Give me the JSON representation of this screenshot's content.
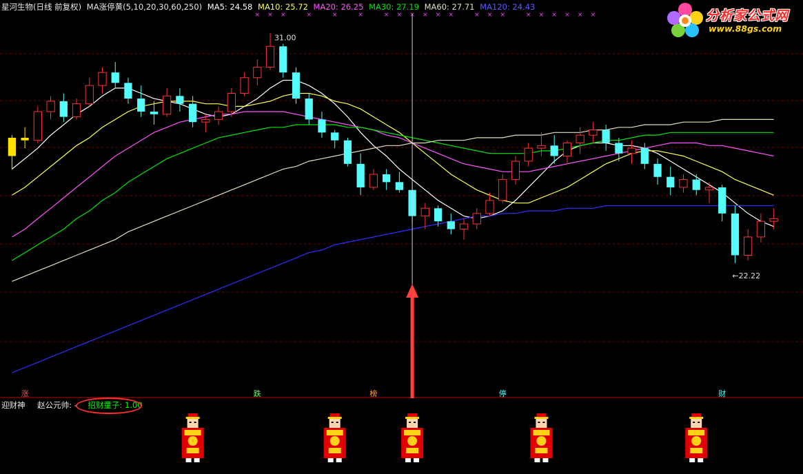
{
  "header": {
    "stock": "星河生物(日线 前复权)",
    "indicator": "MA涨停黄(5,10,20,30,60,250)",
    "ma5": "MA5: 24.58",
    "ma10": "MA10: 25.72",
    "ma20": "MA20: 26.25",
    "ma30": "MA30: 27.19",
    "ma60": "MA60: 27.71",
    "ma120": "MA120: 24.43"
  },
  "logo": {
    "name": "分析家公式网",
    "url": "www.88gs.com"
  },
  "price_labels": {
    "high": "31.00",
    "low": "←22.22"
  },
  "bottom_labels": [
    "涨",
    "跌",
    "榜",
    "停",
    "财"
  ],
  "sub_panel": {
    "title": "迎财神",
    "field1": "赵公元帅: -",
    "field2": "招财童子: 1.00"
  },
  "colors": {
    "background": "#000000",
    "up": "#ff3232",
    "down": "#54fcfc",
    "ma5": "#ffffff",
    "ma10": "#ffff54",
    "ma20": "#ff54ff",
    "ma30": "#00e600",
    "ma60": "#e0e0c0",
    "ma120": "#3030ff",
    "arrow": "#ff4040"
  },
  "chart_data": {
    "type": "candlestick",
    "y_axis_scale": "price",
    "ylim": [
      17.5,
      31.8
    ],
    "high_marker": 31.0,
    "low_marker": 22.22,
    "candles": [
      [
        26.3,
        27.1,
        25.8,
        27.0
      ],
      [
        27.0,
        27.4,
        26.6,
        26.9
      ],
      [
        26.9,
        28.2,
        26.8,
        28.0
      ],
      [
        28.0,
        28.6,
        27.7,
        28.4
      ],
      [
        28.4,
        28.7,
        27.6,
        27.8
      ],
      [
        27.8,
        28.5,
        27.7,
        28.3
      ],
      [
        28.3,
        29.3,
        28.2,
        29.0
      ],
      [
        29.0,
        29.7,
        28.7,
        29.5
      ],
      [
        29.5,
        29.9,
        28.9,
        29.1
      ],
      [
        29.1,
        29.3,
        28.3,
        28.5
      ],
      [
        28.5,
        29.0,
        27.8,
        28.0
      ],
      [
        28.0,
        28.4,
        27.5,
        27.9
      ],
      [
        27.9,
        28.9,
        27.8,
        28.6
      ],
      [
        28.6,
        28.9,
        28.0,
        28.3
      ],
      [
        28.3,
        28.6,
        27.4,
        27.6
      ],
      [
        27.6,
        27.9,
        27.2,
        27.7
      ],
      [
        27.7,
        28.2,
        27.5,
        28.0
      ],
      [
        28.0,
        28.9,
        27.8,
        28.7
      ],
      [
        28.7,
        29.5,
        28.6,
        29.3
      ],
      [
        29.3,
        30.0,
        29.0,
        29.7
      ],
      [
        29.7,
        31.0,
        29.6,
        30.5
      ],
      [
        30.5,
        30.6,
        29.3,
        29.5
      ],
      [
        29.5,
        29.7,
        28.3,
        28.5
      ],
      [
        28.5,
        28.7,
        27.5,
        27.7
      ],
      [
        27.7,
        28.0,
        27.0,
        27.2
      ],
      [
        27.2,
        27.3,
        26.6,
        26.9
      ],
      [
        26.9,
        27.0,
        25.9,
        26.0
      ],
      [
        26.0,
        26.4,
        24.8,
        25.1
      ],
      [
        25.1,
        25.8,
        25.0,
        25.6
      ],
      [
        25.6,
        25.8,
        25.0,
        25.3
      ],
      [
        25.3,
        25.7,
        24.9,
        25.0
      ],
      [
        25.0,
        25.3,
        23.7,
        24.0
      ],
      [
        24.0,
        24.5,
        23.5,
        24.3
      ],
      [
        24.3,
        24.4,
        23.6,
        23.8
      ],
      [
        23.8,
        24.1,
        23.3,
        23.5
      ],
      [
        23.5,
        23.9,
        23.1,
        23.7
      ],
      [
        23.7,
        24.3,
        23.5,
        24.1
      ],
      [
        24.1,
        24.9,
        24.0,
        24.6
      ],
      [
        24.6,
        25.6,
        24.5,
        25.4
      ],
      [
        25.4,
        26.3,
        25.2,
        26.1
      ],
      [
        26.1,
        26.8,
        25.9,
        26.6
      ],
      [
        26.6,
        27.2,
        26.3,
        26.7
      ],
      [
        26.7,
        27.1,
        26.0,
        26.3
      ],
      [
        26.3,
        26.9,
        26.0,
        26.8
      ],
      [
        26.8,
        27.4,
        26.4,
        27.1
      ],
      [
        27.1,
        27.6,
        26.8,
        27.3
      ],
      [
        27.3,
        27.5,
        26.5,
        26.8
      ],
      [
        26.8,
        27.0,
        26.1,
        26.4
      ],
      [
        26.4,
        26.9,
        26.0,
        26.6
      ],
      [
        26.6,
        26.8,
        25.8,
        26.0
      ],
      [
        26.0,
        26.2,
        25.2,
        25.5
      ],
      [
        25.5,
        25.9,
        24.8,
        25.1
      ],
      [
        25.1,
        25.6,
        24.9,
        25.4
      ],
      [
        25.4,
        25.6,
        24.8,
        25.0
      ],
      [
        25.0,
        25.3,
        24.5,
        25.1
      ],
      [
        25.1,
        25.2,
        23.8,
        24.1
      ],
      [
        24.1,
        24.4,
        22.2,
        22.5
      ],
      [
        22.5,
        23.5,
        22.3,
        23.2
      ],
      [
        23.2,
        24.1,
        23.0,
        23.8
      ],
      [
        23.8,
        24.3,
        23.5,
        23.9
      ]
    ],
    "series": [
      {
        "name": "MA5",
        "values": [
          25.8,
          26.2,
          26.6,
          27.1,
          27.5,
          27.9,
          28.2,
          28.6,
          28.9,
          28.9,
          28.7,
          28.5,
          28.4,
          28.3,
          28.1,
          27.9,
          27.8,
          27.9,
          28.2,
          28.5,
          28.9,
          29.2,
          29.2,
          29.0,
          28.7,
          28.3,
          27.8,
          27.2,
          26.7,
          26.3,
          25.8,
          25.4,
          25.0,
          24.6,
          24.3,
          24.0,
          23.9,
          24.0,
          24.2,
          24.6,
          25.1,
          25.6,
          26.1,
          26.5,
          26.7,
          26.8,
          26.8,
          26.7,
          26.7,
          26.6,
          26.4,
          26.1,
          25.8,
          25.5,
          25.2,
          24.9,
          24.5,
          24.1,
          23.8,
          23.6
        ]
      },
      {
        "name": "MA10",
        "values": [
          24.8,
          25.1,
          25.5,
          25.9,
          26.3,
          26.7,
          27.0,
          27.4,
          27.7,
          28.0,
          28.2,
          28.3,
          28.4,
          28.4,
          28.4,
          28.3,
          28.3,
          28.2,
          28.2,
          28.3,
          28.4,
          28.6,
          28.7,
          28.7,
          28.6,
          28.4,
          28.3,
          28.1,
          27.8,
          27.5,
          27.2,
          26.8,
          26.4,
          26.0,
          25.6,
          25.3,
          25.0,
          24.8,
          24.6,
          24.5,
          24.5,
          24.7,
          24.9,
          25.1,
          25.4,
          25.7,
          26.0,
          26.2,
          26.4,
          26.5,
          26.5,
          26.4,
          26.3,
          26.1,
          25.9,
          25.7,
          25.4,
          25.2,
          25.0,
          24.8
        ]
      },
      {
        "name": "MA20",
        "values": [
          23.2,
          23.5,
          23.9,
          24.3,
          24.7,
          25.1,
          25.5,
          25.9,
          26.3,
          26.6,
          26.9,
          27.2,
          27.4,
          27.6,
          27.7,
          27.8,
          27.9,
          27.9,
          28.0,
          28.0,
          28.0,
          28.0,
          27.9,
          27.8,
          27.7,
          27.6,
          27.5,
          27.4,
          27.3,
          27.1,
          27.0,
          26.8,
          26.6,
          26.4,
          26.2,
          26.0,
          25.9,
          25.8,
          25.7,
          25.7,
          25.7,
          25.8,
          25.9,
          26.0,
          26.1,
          26.2,
          26.3,
          26.4,
          26.5,
          26.6,
          26.7,
          26.8,
          26.8,
          26.8,
          26.7,
          26.7,
          26.6,
          26.5,
          26.4,
          26.3
        ]
      },
      {
        "name": "MA30",
        "values": [
          22.3,
          22.6,
          22.9,
          23.2,
          23.5,
          23.9,
          24.2,
          24.6,
          24.9,
          25.3,
          25.6,
          25.9,
          26.2,
          26.4,
          26.6,
          26.8,
          27.0,
          27.1,
          27.2,
          27.3,
          27.4,
          27.4,
          27.5,
          27.5,
          27.5,
          27.5,
          27.4,
          27.4,
          27.3,
          27.2,
          27.1,
          27.0,
          26.9,
          26.8,
          26.7,
          26.6,
          26.5,
          26.4,
          26.4,
          26.4,
          26.4,
          26.5,
          26.5,
          26.6,
          26.7,
          26.8,
          26.9,
          26.9,
          27.0,
          27.1,
          27.1,
          27.2,
          27.2,
          27.2,
          27.2,
          27.2,
          27.2,
          27.2,
          27.2,
          27.2
        ]
      },
      {
        "name": "MA60",
        "values": [
          21.5,
          21.7,
          21.9,
          22.1,
          22.3,
          22.5,
          22.7,
          22.9,
          23.1,
          23.4,
          23.6,
          23.8,
          24.0,
          24.2,
          24.4,
          24.6,
          24.8,
          25.0,
          25.2,
          25.4,
          25.6,
          25.8,
          25.9,
          26.1,
          26.2,
          26.3,
          26.4,
          26.5,
          26.6,
          26.7,
          26.7,
          26.8,
          26.8,
          26.9,
          26.9,
          26.9,
          27.0,
          27.0,
          27.0,
          27.1,
          27.1,
          27.1,
          27.2,
          27.2,
          27.2,
          27.3,
          27.3,
          27.4,
          27.4,
          27.5,
          27.5,
          27.5,
          27.6,
          27.6,
          27.6,
          27.7,
          27.7,
          27.7,
          27.7,
          27.7
        ]
      },
      {
        "name": "MA120",
        "values": [
          18.0,
          18.2,
          18.4,
          18.6,
          18.8,
          19.0,
          19.2,
          19.4,
          19.6,
          19.8,
          20.0,
          20.2,
          20.4,
          20.6,
          20.8,
          21.0,
          21.2,
          21.4,
          21.6,
          21.8,
          22.0,
          22.2,
          22.4,
          22.6,
          22.7,
          22.9,
          23.0,
          23.1,
          23.2,
          23.3,
          23.4,
          23.5,
          23.6,
          23.7,
          23.8,
          23.9,
          24.0,
          24.0,
          24.1,
          24.1,
          24.2,
          24.2,
          24.2,
          24.3,
          24.3,
          24.3,
          24.4,
          24.4,
          24.4,
          24.4,
          24.4,
          24.4,
          24.4,
          24.4,
          24.4,
          24.4,
          24.4,
          24.4,
          24.4,
          24.4
        ]
      }
    ],
    "limit_up_bars": [
      0,
      1
    ],
    "signal_index": 31,
    "mascot_positions": [
      14,
      25,
      31,
      41,
      53
    ]
  }
}
